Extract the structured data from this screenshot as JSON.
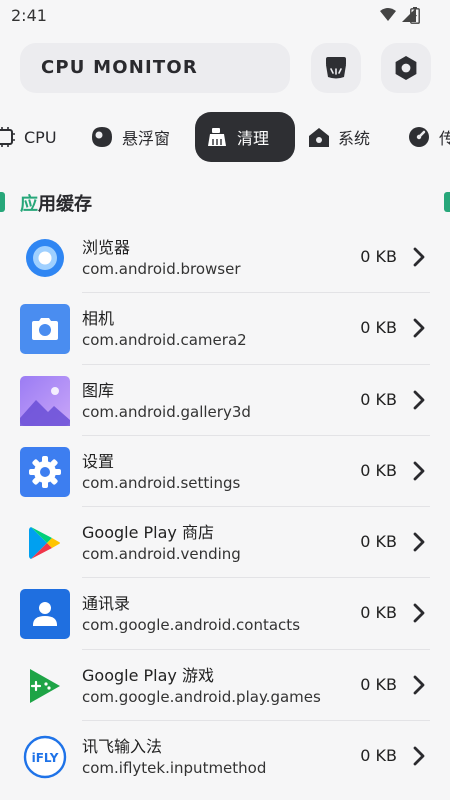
{
  "status": {
    "time": "2:41"
  },
  "header": {
    "title": "CPU MONITOR"
  },
  "tabs": [
    {
      "label": "CPU",
      "icon": "chip-icon"
    },
    {
      "label": "悬浮窗",
      "icon": "floating-window-icon"
    },
    {
      "label": "清理",
      "icon": "broom-icon",
      "active": true
    },
    {
      "label": "系统",
      "icon": "home-icon"
    },
    {
      "label": "传",
      "icon": "sensor-icon"
    }
  ],
  "section": {
    "title_accent": "应",
    "title_rest": "用缓存"
  },
  "apps": [
    {
      "name": "浏览器",
      "package": "com.android.browser",
      "size": "0 KB",
      "icon": "browser-icon"
    },
    {
      "name": "相机",
      "package": "com.android.camera2",
      "size": "0 KB",
      "icon": "camera-icon"
    },
    {
      "name": "图库",
      "package": "com.android.gallery3d",
      "size": "0 KB",
      "icon": "gallery-icon"
    },
    {
      "name": "设置",
      "package": "com.android.settings",
      "size": "0 KB",
      "icon": "settings-icon"
    },
    {
      "name": "Google Play 商店",
      "package": "com.android.vending",
      "size": "0 KB",
      "icon": "play-store-icon"
    },
    {
      "name": "通讯录",
      "package": "com.google.android.contacts",
      "size": "0 KB",
      "icon": "contacts-icon"
    },
    {
      "name": "Google Play 游戏",
      "package": "com.google.android.play.games",
      "size": "0 KB",
      "icon": "play-games-icon"
    },
    {
      "name": "讯飞输入法",
      "package": "com.iflytek.inputmethod",
      "size": "0 KB",
      "icon": "ifly-icon",
      "icon_text": "iFLY"
    }
  ],
  "colors": {
    "accent": "#27a77a",
    "active_tab": "#2e2f33",
    "background": "#f6f6f7"
  }
}
